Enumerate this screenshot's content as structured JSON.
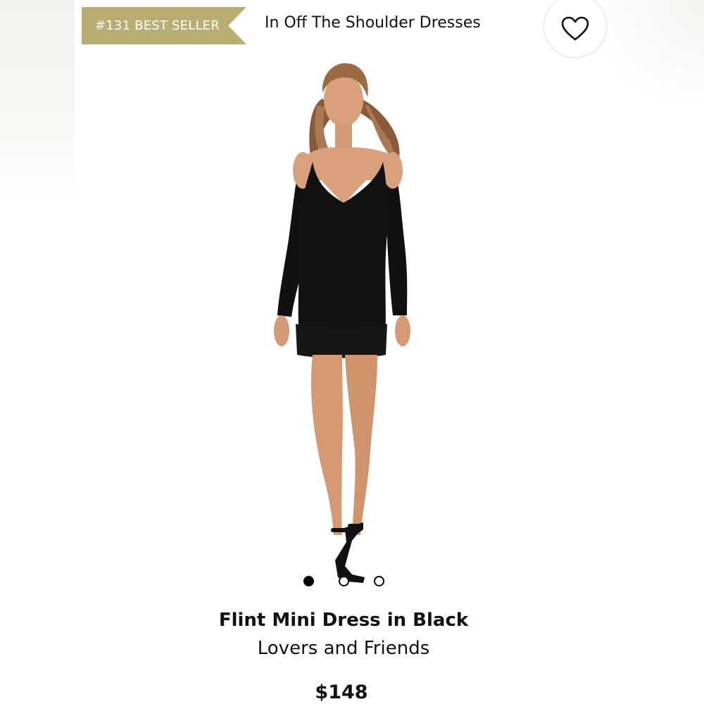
{
  "badge": {
    "text": "#131 BEST SELLER",
    "color": "#b8ad72"
  },
  "category": {
    "text": "In Off The Shoulder Dresses"
  },
  "wishlist": {
    "icon": "heart-icon"
  },
  "gallery": {
    "image_description_icon": "product-photo",
    "dots": [
      {
        "state": "active"
      },
      {
        "state": "inactive"
      },
      {
        "state": "inactive"
      }
    ],
    "current_index": 1,
    "total": 3
  },
  "product": {
    "name": "Flint Mini Dress in Black",
    "brand": "Lovers and Friends",
    "price": "$148"
  }
}
